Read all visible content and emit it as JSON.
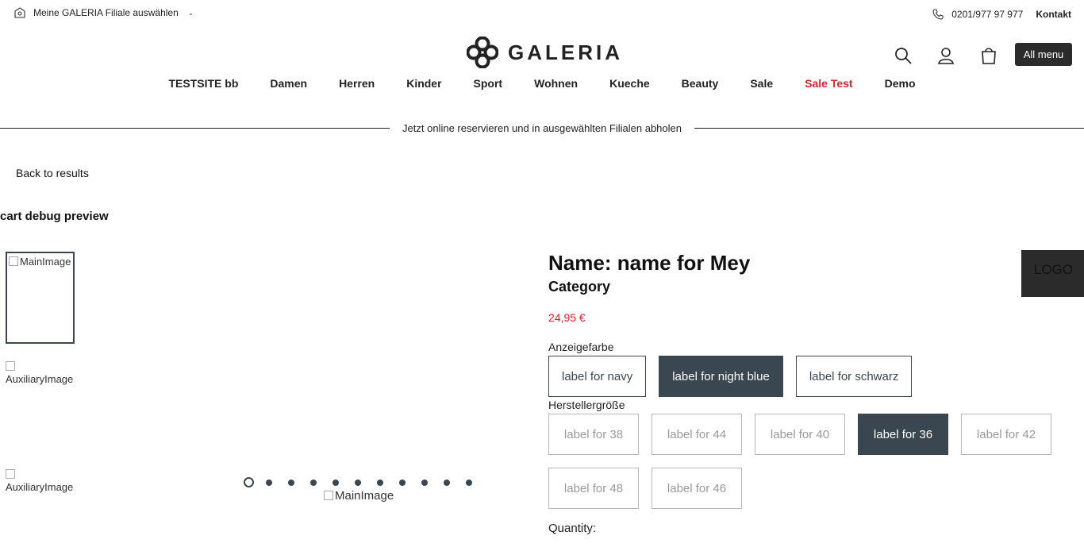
{
  "topbar": {
    "store_select_label": "Meine GALERIA Filiale auswählen",
    "phone": "0201/977 97 977",
    "contact_label": "Kontakt"
  },
  "header": {
    "logo_text": "GALERIA",
    "all_menu_label": "All menu"
  },
  "nav": {
    "items": [
      "TESTSITE bb",
      "Damen",
      "Herren",
      "Kinder",
      "Sport",
      "Wohnen",
      "Kueche",
      "Beauty",
      "Sale",
      "Sale Test",
      "Demo"
    ]
  },
  "promo": {
    "text": "Jetzt online reservieren und in ausgewählten Filialen abholen"
  },
  "page": {
    "back_label": "Back to results",
    "debug_title": "cart debug preview"
  },
  "gallery": {
    "main_thumb_alt": "MainImage",
    "aux1_alt": "AuxiliaryImage",
    "aux2_alt": "AuxiliaryImage",
    "main_image_alt": "MainImage",
    "dot_count": 11,
    "active_dot": 0
  },
  "product": {
    "name": "Name: name for Mey",
    "category": "Category",
    "price": "24,95 €",
    "color_label": "Anzeigefarbe",
    "colors": [
      {
        "label": "label for navy",
        "selected": false
      },
      {
        "label": "label for night blue",
        "selected": true
      },
      {
        "label": "label for schwarz",
        "selected": false
      }
    ],
    "size_label": "Herstellergröße",
    "sizes": [
      {
        "label": "label for 38",
        "selected": false
      },
      {
        "label": "label for 44",
        "selected": false
      },
      {
        "label": "label for 40",
        "selected": false
      },
      {
        "label": "label for 36",
        "selected": true
      },
      {
        "label": "label for 42",
        "selected": false
      },
      {
        "label": "label for 48",
        "selected": false
      },
      {
        "label": "label for 46",
        "selected": false
      }
    ],
    "quantity_label": "Quantity:",
    "brand_logo_text": "LOGO"
  },
  "colors": {
    "accent": "#3a4750",
    "sale": "#d6252f",
    "dark": "#2b2b2b"
  }
}
